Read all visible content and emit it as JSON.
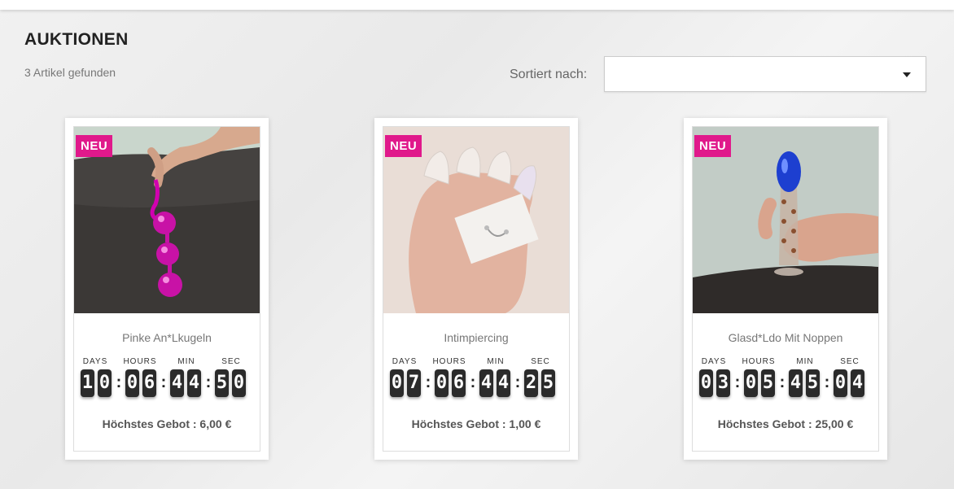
{
  "header": {
    "title": "AUKTIONEN",
    "count": "3 Artikel gefunden"
  },
  "sort": {
    "label": "Sortiert nach:",
    "selected": ""
  },
  "colors": {
    "badge": "#e0198b",
    "digit_bg": "#2b2b2b"
  },
  "countdown_labels": {
    "days": "DAYS",
    "hours": "HOURS",
    "min": "MIN",
    "sec": "SEC"
  },
  "products": [
    {
      "badge": "NEU",
      "name": "Pinke An*Lkugeln",
      "countdown": {
        "days": [
          "1",
          "0"
        ],
        "hours": [
          "0",
          "6"
        ],
        "min": [
          "4",
          "4"
        ],
        "sec": [
          "5",
          "0"
        ]
      },
      "bid": "Höchstes Gebot : 6,00 €"
    },
    {
      "badge": "NEU",
      "name": "Intimpiercing",
      "countdown": {
        "days": [
          "0",
          "7"
        ],
        "hours": [
          "0",
          "6"
        ],
        "min": [
          "4",
          "4"
        ],
        "sec": [
          "2",
          "5"
        ]
      },
      "bid": "Höchstes Gebot : 1,00 €"
    },
    {
      "badge": "NEU",
      "name": "Glasd*Ldo Mit Noppen",
      "countdown": {
        "days": [
          "0",
          "3"
        ],
        "hours": [
          "0",
          "5"
        ],
        "min": [
          "4",
          "5"
        ],
        "sec": [
          "0",
          "4"
        ]
      },
      "bid": "Höchstes Gebot : 25,00 €"
    }
  ]
}
